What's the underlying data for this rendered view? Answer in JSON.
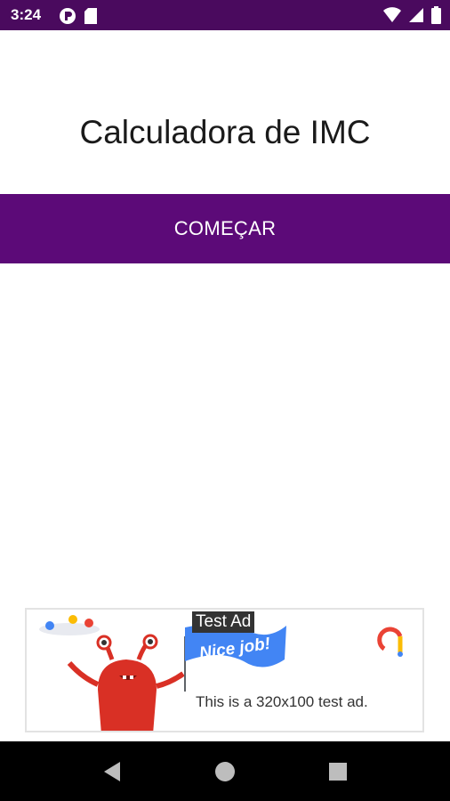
{
  "status_bar": {
    "time": "3:24",
    "icons_left": [
      "app-notification-icon",
      "sd-card-icon"
    ],
    "icons_right": [
      "wifi-icon",
      "signal-icon",
      "battery-icon"
    ]
  },
  "app": {
    "title": "Calculadora de IMC",
    "start_button_label": "COMEÇAR",
    "accent_color": "#5c0a78",
    "status_bar_color": "#4a0a5e"
  },
  "ad": {
    "label": "Test Ad",
    "flag_text": "Nice job!",
    "text": "This is a 320x100 test ad."
  },
  "nav_bar": {
    "icons": [
      "back-icon",
      "home-icon",
      "recents-icon"
    ]
  }
}
